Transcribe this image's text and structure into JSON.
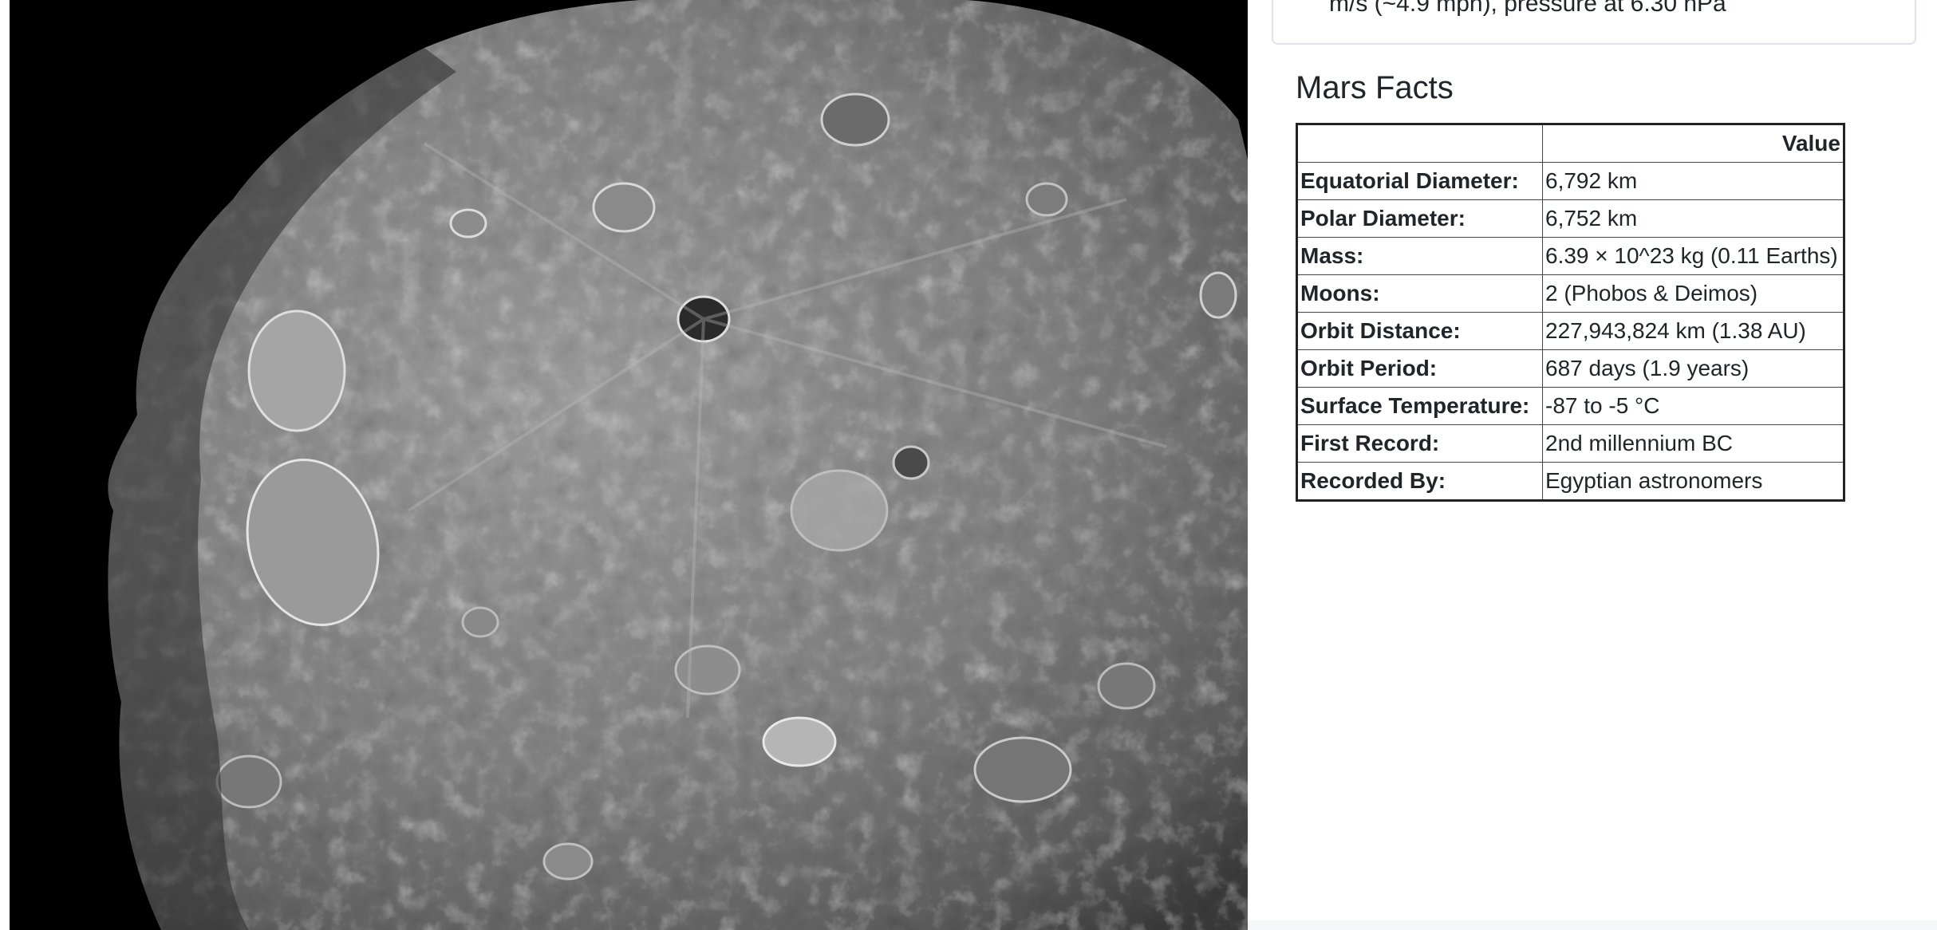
{
  "hero": {
    "alt_icon": "asteroid-image"
  },
  "weather": {
    "text": "m/s (~4.9 mph), pressure at 6.30 hPa"
  },
  "facts": {
    "title": "Mars Facts",
    "header_label": "",
    "header_value": "Value",
    "rows": [
      {
        "label": "Equatorial Diameter:",
        "value": "6,792 km"
      },
      {
        "label": "Polar Diameter:",
        "value": "6,752 km"
      },
      {
        "label": "Mass:",
        "value": "6.39 × 10^23 kg (0.11 Earths)"
      },
      {
        "label": "Moons:",
        "value": "2 (Phobos & Deimos)"
      },
      {
        "label": "Orbit Distance:",
        "value": "227,943,824 km (1.38 AU)"
      },
      {
        "label": "Orbit Period:",
        "value": "687 days (1.9 years)"
      },
      {
        "label": "Surface Temperature:",
        "value": "-87 to -5 °C"
      },
      {
        "label": "First Record:",
        "value": "2nd millennium BC"
      },
      {
        "label": "Recorded By:",
        "value": "Egyptian astronomers"
      }
    ]
  },
  "colors": {
    "text": "#212529",
    "card_border": "#dfe3e7",
    "table_border": "#222222",
    "image_bg": "#000000"
  }
}
